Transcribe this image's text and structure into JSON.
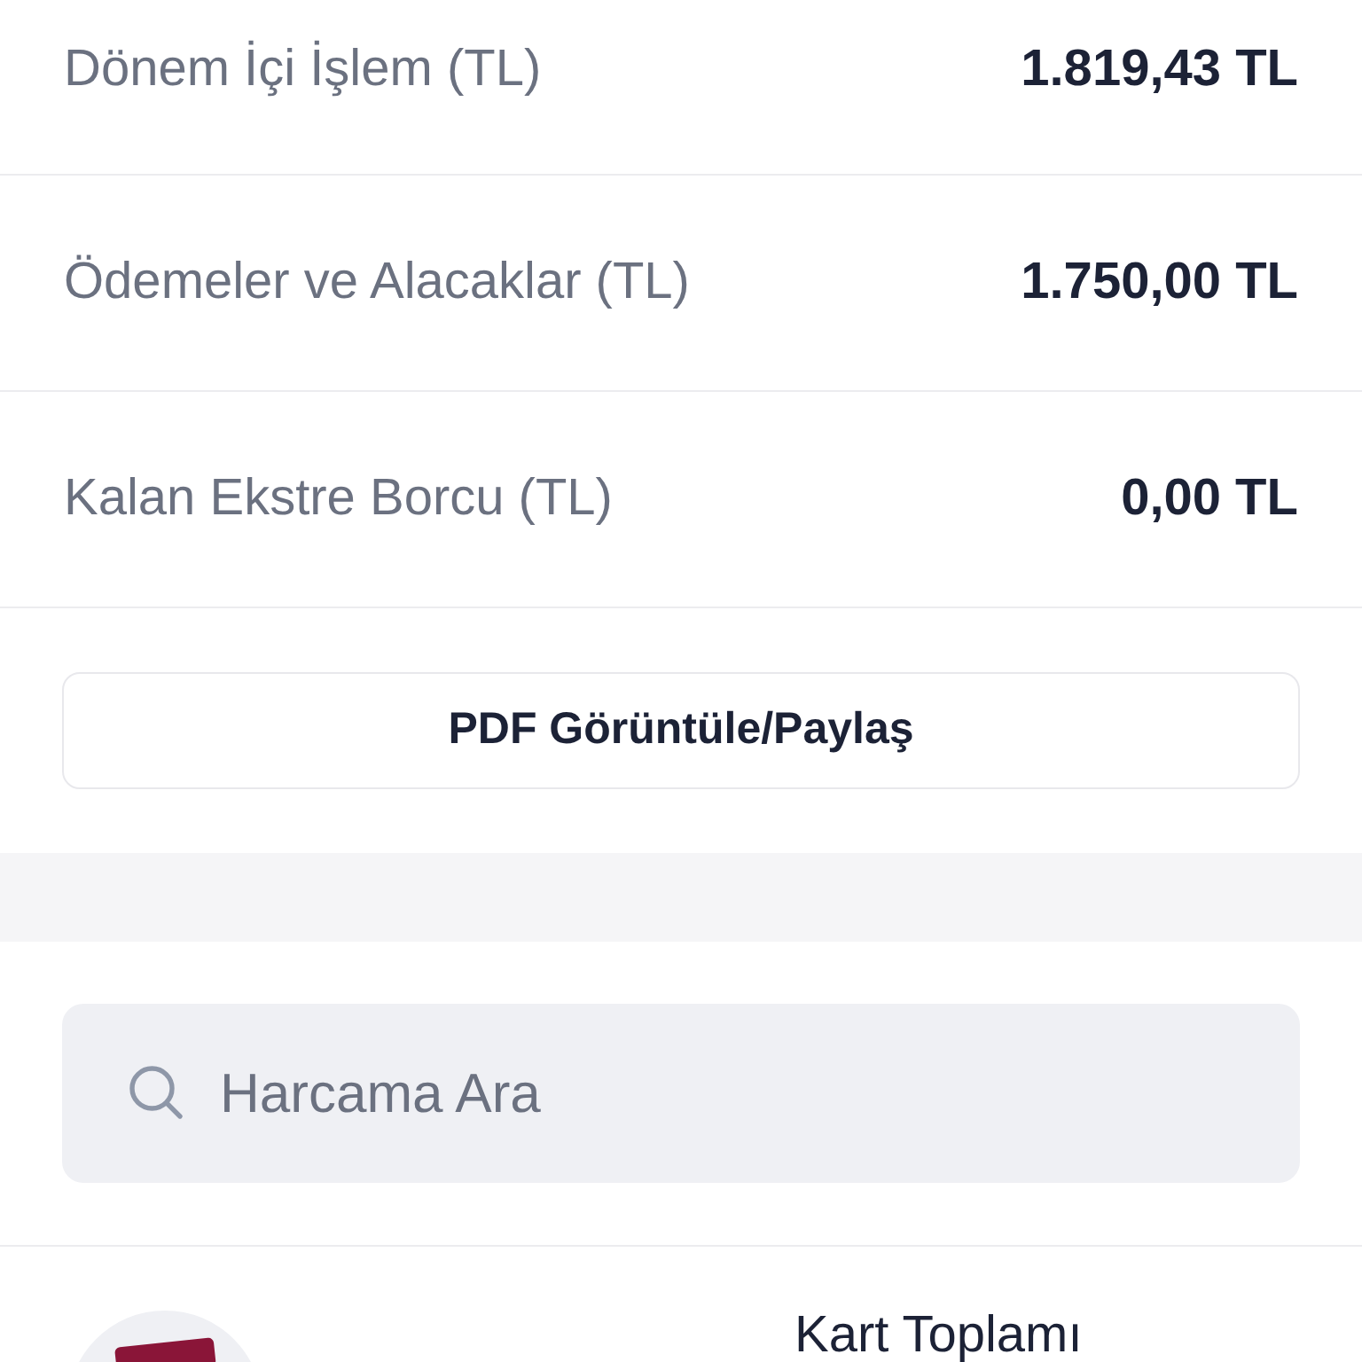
{
  "summary_rows": [
    {
      "label": "Dönem İçi İşlem (TL)",
      "value": "1.819,43 TL"
    },
    {
      "label": "Ödemeler ve Alacaklar (TL)",
      "value": "1.750,00 TL"
    },
    {
      "label": "Kalan Ekstre Borcu (TL)",
      "value": "0,00 TL"
    }
  ],
  "pdf_button": "PDF Görüntüle/Paylaş",
  "search": {
    "placeholder": "Harcama Ara"
  },
  "card_total": {
    "label": "Kart Toplamı"
  }
}
